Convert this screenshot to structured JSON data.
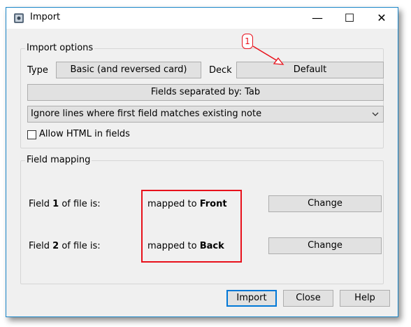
{
  "window": {
    "title": "Import",
    "controls": {
      "minimize": "—",
      "maximize": "☐",
      "close": "✕"
    }
  },
  "import_options": {
    "group_label": "Import options",
    "type_label": "Type",
    "type_value": "Basic (and reversed card)",
    "deck_label": "Deck",
    "deck_value": "Default",
    "fields_separated": "Fields separated by: Tab",
    "duplicate_mode": "Ignore lines where first field matches existing note",
    "allow_html_label": "Allow HTML in fields",
    "allow_html_checked": false
  },
  "field_mapping": {
    "group_label": "Field mapping",
    "rows": [
      {
        "field_prefix": "Field ",
        "field_num": "1",
        "field_suffix": " of file is:",
        "mapped_prefix": "mapped to ",
        "mapped_target": "Front",
        "change_label": "Change"
      },
      {
        "field_prefix": "Field ",
        "field_num": "2",
        "field_suffix": " of file is:",
        "mapped_prefix": "mapped to ",
        "mapped_target": "Back",
        "change_label": "Change"
      }
    ]
  },
  "buttons": {
    "import": "Import",
    "close": "Close",
    "help": "Help"
  },
  "annotation": {
    "number": "1",
    "color": "#e8111b"
  }
}
